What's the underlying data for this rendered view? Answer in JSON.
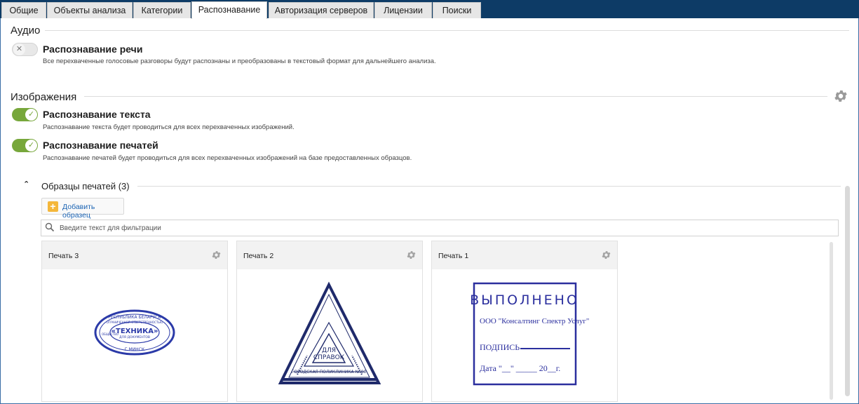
{
  "tabs": [
    {
      "label": "Общие"
    },
    {
      "label": "Объекты анализа"
    },
    {
      "label": "Категории"
    },
    {
      "label": "Распознавание"
    },
    {
      "label": "Авторизация серверов"
    },
    {
      "label": "Лицензии"
    },
    {
      "label": "Поиски"
    }
  ],
  "active_tab": "Распознавание",
  "audio": {
    "title": "Аудио",
    "speech": {
      "label": "Распознавание речи",
      "enabled": false,
      "description": "Все перехваченные голосовые разговоры будут распознаны и преобразованы в текстовый формат для дальнейшего анализа."
    }
  },
  "images": {
    "title": "Изображения",
    "text": {
      "label": "Распознавание текста",
      "enabled": true,
      "description": "Распознавание текста будет проводиться для всех перехваченных изображений."
    },
    "stamps": {
      "label": "Распознавание печатей",
      "enabled": true,
      "description": "Распознавание печатей будет проводиться для всех перехваченных изображений на базе предоставленных образцов."
    }
  },
  "samples": {
    "title": "Образцы печатей (3)",
    "add_label": "Добавить образец",
    "filter_placeholder": "Введите текст для фильтрации",
    "cards": [
      {
        "title": "Печать 3"
      },
      {
        "title": "Печать 2"
      },
      {
        "title": "Печать 1"
      }
    ]
  },
  "stamp3": {
    "top_text": "РЕСПУБЛИКА БЕЛАРУСЬ",
    "inner_text": "ОГРАНИЧЕННОЙ ОТВЕТСТВЕННОСТЬЮ",
    "main": "«ТЕХНИКА»",
    "sub": "ДЛЯ ДОКУМЕНТОВ",
    "left_text": "ОБЩЕСТВО",
    "bottom": "Г.МИНСК"
  },
  "stamp2": {
    "center1": "ДЛЯ",
    "center2": "СПРАВОК",
    "bottom": "ГОРОДСКАЯ ПОЛИКЛИНИКА № 00"
  },
  "stamp1": {
    "line1": "ВЫПОЛНЕНО",
    "line2": "ООО \"Консалтинг Спектр Услуг\"",
    "line3": "ПОДПИСЬ",
    "line4": "Дата  \"__\" _____ 20__г."
  },
  "colors": {
    "tabbar": "#0d3b66",
    "toggle_on": "#77a73b",
    "stamp_blue": "#2b3aa8",
    "stamp_navy": "#1f2a6b",
    "link": "#1c64b4"
  }
}
